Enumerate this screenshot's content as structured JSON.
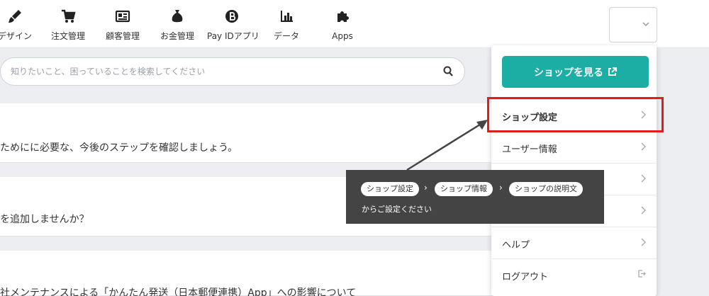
{
  "nav": {
    "items": [
      {
        "label": "デザイン",
        "icon": "brush-icon"
      },
      {
        "label": "注文管理",
        "icon": "cart-icon"
      },
      {
        "label": "顧客管理",
        "icon": "id-card-icon"
      },
      {
        "label": "お金管理",
        "icon": "money-bag-icon"
      },
      {
        "label": "Pay IDアプリ",
        "icon": "payid-icon"
      },
      {
        "label": "データ",
        "icon": "bar-chart-icon"
      },
      {
        "label": "Apps",
        "icon": "puzzle-icon"
      }
    ]
  },
  "search": {
    "placeholder": "知りたいこと、困っていることを検索してください"
  },
  "cards": [
    {
      "text": "ためにに必要な、今後のステップを確認しましょう。"
    },
    {
      "text": "を追加しませんか？"
    },
    {
      "text": "社メンテナンスによる「かんたん発送（日本郵便連携）App」への影響について"
    }
  ],
  "dropdown": {
    "view_shop": "ショップを見る",
    "items": [
      {
        "label": "ショップ設定"
      },
      {
        "label": "ユーザー情報"
      },
      {
        "label": ""
      },
      {
        "label": ""
      },
      {
        "label": "ヘルプ"
      },
      {
        "label": "ログアウト"
      }
    ]
  },
  "annotation": {
    "steps": [
      "ショップ設定",
      "ショップ情報",
      "ショップの説明文"
    ],
    "note": "からご設定ください"
  },
  "colors": {
    "accent": "#1cada5",
    "highlight": "#e11c1c",
    "annotation_bg": "#444444"
  }
}
